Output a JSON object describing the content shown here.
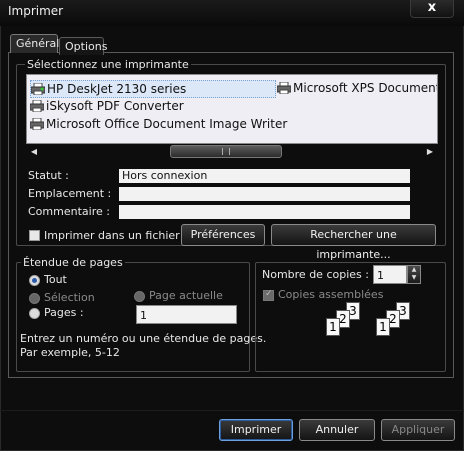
{
  "window": {
    "title": "Imprimer",
    "close_glyph": "x"
  },
  "tabs": [
    {
      "label": "Général"
    },
    {
      "label": "Options"
    }
  ],
  "printer_group": {
    "label": "Sélectionnez une imprimante",
    "printers": [
      {
        "name": "HP DeskJet 2130 series",
        "icon": "printer-icon-green"
      },
      {
        "name": "iSkysoft PDF Converter",
        "icon": "printer-icon"
      },
      {
        "name": "Microsoft Office Document Image Writer",
        "icon": "printer-icon"
      },
      {
        "name": "Microsoft XPS Document W",
        "icon": "printer-icon"
      }
    ],
    "status_label": "Statut :",
    "status_value": "Hors connexion",
    "location_label": "Emplacement :",
    "location_value": "",
    "comment_label": "Commentaire :",
    "comment_value": "",
    "print_to_file_label": "Imprimer dans un fichier",
    "preferences_button": "Préférences",
    "find_printer_button": "Rechercher une imprimante..."
  },
  "page_range": {
    "label": "Étendue de pages",
    "all_label": "Tout",
    "selection_label": "Sélection",
    "current_page_label": "Page actuelle",
    "pages_label": "Pages :",
    "pages_value": "1",
    "help_line1": "Entrez un numéro ou une étendue de pages.",
    "help_line2": "Par exemple, 5-12"
  },
  "copies": {
    "label": "Nombre de copies :",
    "value": "1",
    "collate_label": "Copies assemblées"
  },
  "footer": {
    "print_button": "Imprimer",
    "cancel_button": "Annuler",
    "apply_button": "Appliquer"
  },
  "colors": {
    "selection": "#dce8f8",
    "accent": "#2b5aa8"
  }
}
